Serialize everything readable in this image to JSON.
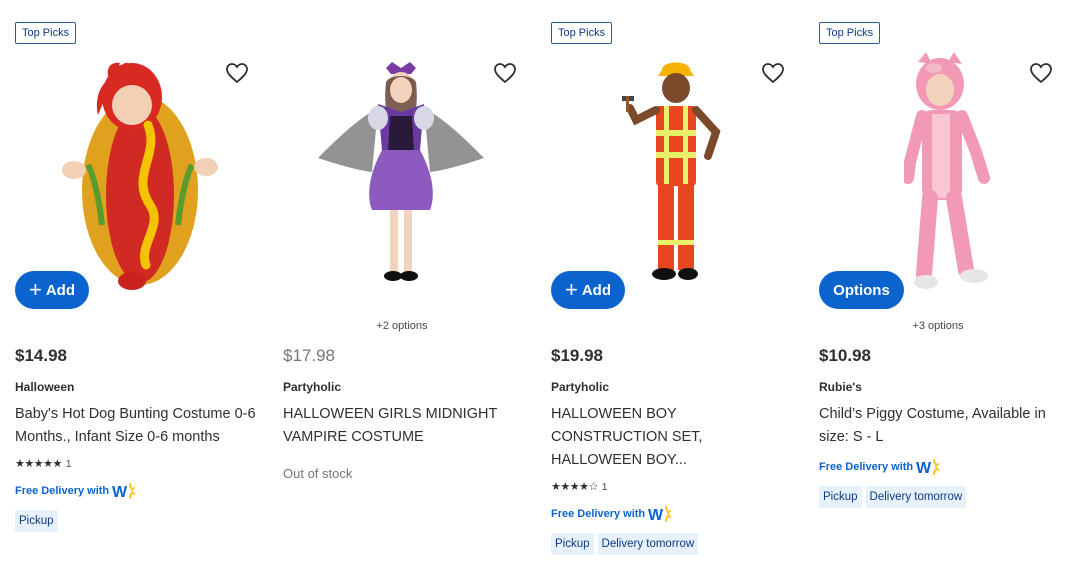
{
  "colors": {
    "accent": "#0b63ce",
    "badge_border": "#2d5a9e",
    "chip_bg": "#e6f1fc",
    "spark": "#ffc220"
  },
  "products": [
    {
      "badge": "Top Picks",
      "action_label": "Add",
      "price": "$14.98",
      "brand": "Halloween",
      "title": "Baby's Hot Dog Bunting Costume 0-6 Months., Infant Size 0-6 months",
      "rating_stars": "★★★★★",
      "rating_value": 5,
      "review_count": "1",
      "delivery": "Free Delivery with",
      "chips": [
        "Pickup"
      ]
    },
    {
      "options_note": "+2 options",
      "price": "$17.98",
      "brand": "Partyholic",
      "title": "HALLOWEEN GIRLS MIDNIGHT VAMPIRE COSTUME",
      "stock": "Out of stock"
    },
    {
      "badge": "Top Picks",
      "action_label": "Add",
      "price": "$19.98",
      "brand": "Partyholic",
      "title": "HALLOWEEN BOY CONSTRUCTION SET, HALLOWEEN BOY...",
      "rating_stars": "★★★★☆",
      "rating_value": 4,
      "review_count": "1",
      "delivery": "Free Delivery with",
      "chips": [
        "Pickup",
        "Delivery tomorrow"
      ]
    },
    {
      "badge": "Top Picks",
      "action_label": "Options",
      "options_note": "+3 options",
      "price": "$10.98",
      "brand": "Rubie's",
      "title": "Child’s Piggy Costume, Available in size: S - L",
      "delivery": "Free Delivery with",
      "chips": [
        "Pickup",
        "Delivery tomorrow"
      ]
    }
  ]
}
